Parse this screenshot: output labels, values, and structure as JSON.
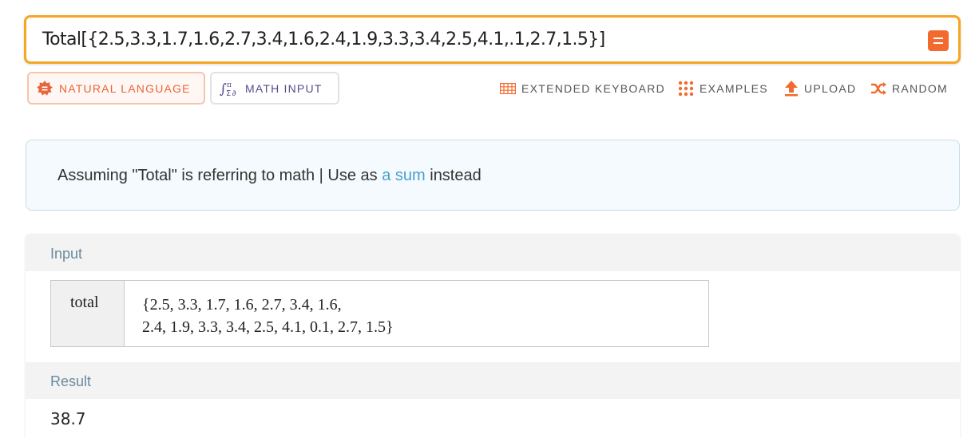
{
  "query": {
    "text": "Total[{2.5,3.3,1.7,1.6,2.7,3.4,1.6,2.4,1.9,3.3,3.4,2.5,4.1,.1,2.7,1.5}]",
    "border_color": "#f5a623",
    "submit_icon": "equals-icon",
    "submit_color": "#f26a2e"
  },
  "modes": [
    {
      "label": "NATURAL LANGUAGE",
      "icon": "natural-language-icon",
      "active": true,
      "color": "#e8643b"
    },
    {
      "label": "MATH INPUT",
      "icon": "math-input-icon",
      "active": false,
      "color": "#5a4a8e"
    }
  ],
  "toolbar": [
    {
      "label": "EXTENDED KEYBOARD",
      "icon": "keyboard-icon"
    },
    {
      "label": "EXAMPLES",
      "icon": "examples-grid-icon"
    },
    {
      "label": "UPLOAD",
      "icon": "upload-icon"
    },
    {
      "label": "RANDOM",
      "icon": "shuffle-icon"
    }
  ],
  "assumption": {
    "prefix": "Assuming \"Total\" is referring to math | Use as ",
    "link": "a sum",
    "suffix": " instead",
    "link_color": "#4a9fd0"
  },
  "pods": {
    "input": {
      "title": "Input",
      "label": "total",
      "value_line1": "{2.5, 3.3, 1.7, 1.6, 2.7, 3.4, 1.6,",
      "value_line2": "2.4, 1.9, 3.3, 3.4, 2.5, 4.1, 0.1, 2.7, 1.5}"
    },
    "result": {
      "title": "Result",
      "value": "38.7"
    }
  }
}
